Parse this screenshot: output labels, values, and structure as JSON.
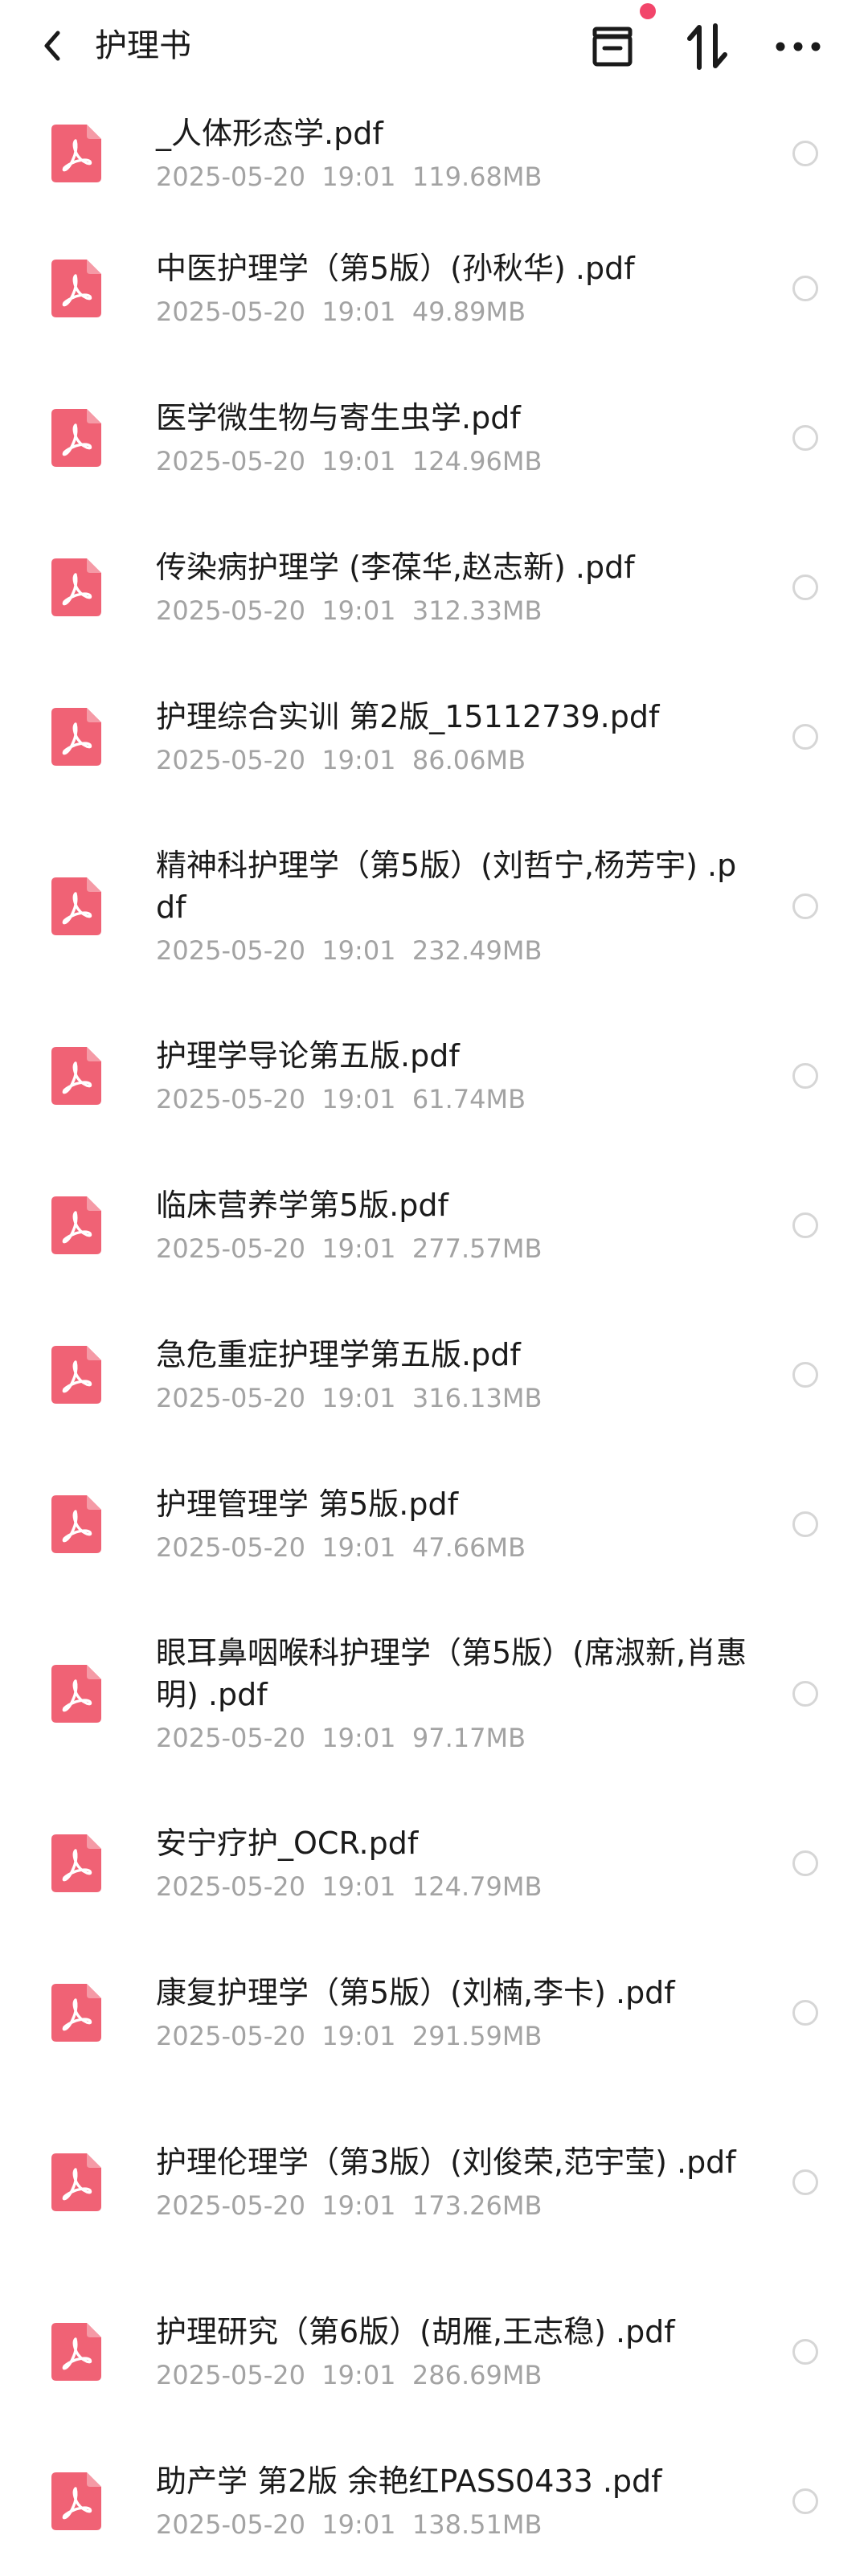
{
  "header": {
    "title": "护理书"
  },
  "files": [
    {
      "name": "_人体形态学.pdf",
      "date": "2025-05-20",
      "time": "19:01",
      "size": "119.68MB"
    },
    {
      "name": "中医护理学（第5版）(孙秋华) .pdf",
      "date": "2025-05-20",
      "time": "19:01",
      "size": "49.89MB"
    },
    {
      "name": "医学微生物与寄生虫学.pdf",
      "date": "2025-05-20",
      "time": "19:01",
      "size": "124.96MB"
    },
    {
      "name": "传染病护理学 (李葆华,赵志新) .pdf",
      "date": "2025-05-20",
      "time": "19:01",
      "size": "312.33MB"
    },
    {
      "name": "护理综合实训 第2版_15112739.pdf",
      "date": "2025-05-20",
      "time": "19:01",
      "size": "86.06MB"
    },
    {
      "name": "精神科护理学（第5版）(刘哲宁,杨芳宇) .pdf",
      "date": "2025-05-20",
      "time": "19:01",
      "size": "232.49MB"
    },
    {
      "name": "护理学导论第五版.pdf",
      "date": "2025-05-20",
      "time": "19:01",
      "size": "61.74MB"
    },
    {
      "name": "临床营养学第5版.pdf",
      "date": "2025-05-20",
      "time": "19:01",
      "size": "277.57MB"
    },
    {
      "name": "急危重症护理学第五版.pdf",
      "date": "2025-05-20",
      "time": "19:01",
      "size": "316.13MB"
    },
    {
      "name": "护理管理学 第5版.pdf",
      "date": "2025-05-20",
      "time": "19:01",
      "size": "47.66MB"
    },
    {
      "name": "眼耳鼻咽喉科护理学（第5版）(席淑新,肖惠明) .pdf",
      "date": "2025-05-20",
      "time": "19:01",
      "size": "97.17MB"
    },
    {
      "name": "安宁疗护_OCR.pdf",
      "date": "2025-05-20",
      "time": "19:01",
      "size": "124.79MB"
    },
    {
      "name": "康复护理学（第5版）(刘楠,李卡) .pdf",
      "date": "2025-05-20",
      "time": "19:01",
      "size": "291.59MB"
    },
    {
      "name": "护理伦理学（第3版）(刘俊荣,范宇莹) .pdf",
      "date": "2025-05-20",
      "time": "19:01",
      "size": "173.26MB"
    },
    {
      "name": "护理研究（第6版）(胡雁,王志稳) .pdf",
      "date": "2025-05-20",
      "time": "19:01",
      "size": "286.69MB"
    },
    {
      "name": "助产学 第2版 余艳红PASS0433 .pdf",
      "date": "2025-05-20",
      "time": "19:01",
      "size": "138.51MB"
    }
  ],
  "colors": {
    "pdf_icon": "#f06275",
    "meta_text": "#a3a3a3",
    "notification_dot": "#f2456a"
  },
  "icons": {
    "back": "chevron-left-icon",
    "archive": "archive-box-icon",
    "sort": "sort-arrows-icon",
    "more": "more-horizontal-icon",
    "file": "pdf-file-icon",
    "select": "radio-circle-icon"
  }
}
